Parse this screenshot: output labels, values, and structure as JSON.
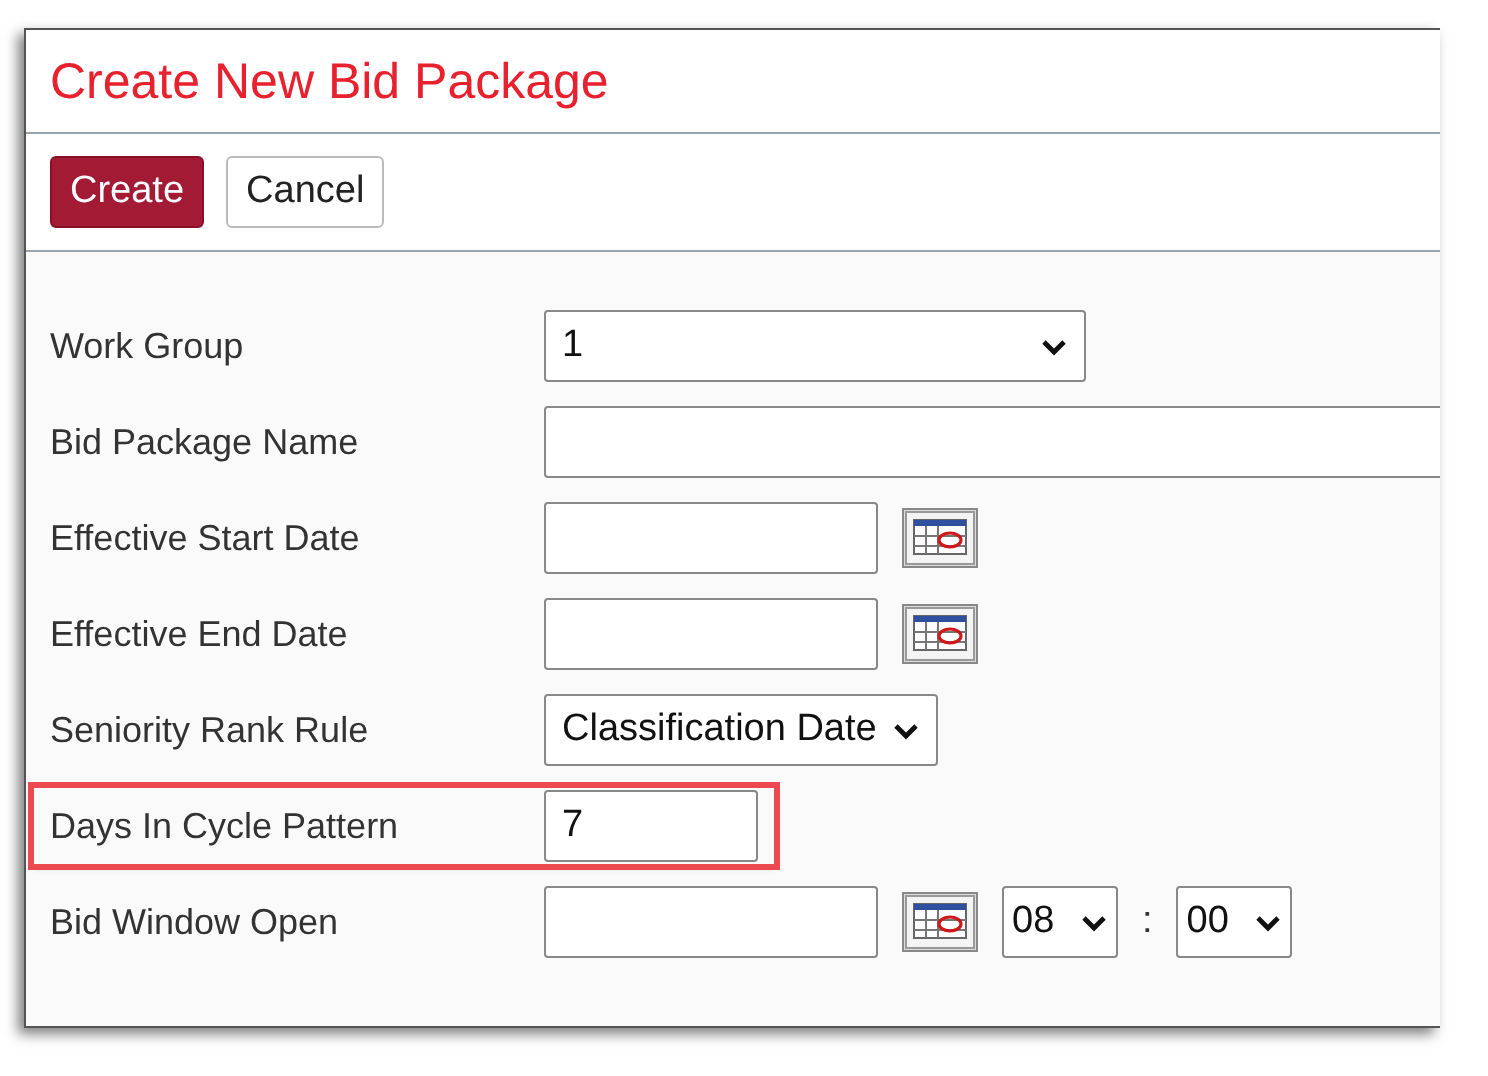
{
  "title": "Create New Bid Package",
  "buttons": [
    {
      "label": "Create",
      "kind": "primary"
    },
    {
      "label": "Cancel",
      "kind": "default"
    }
  ],
  "fields": [
    {
      "label": "Work Group",
      "kind": "select",
      "value": "1",
      "highlighted": false
    },
    {
      "label": "Bid Package Name",
      "kind": "text",
      "highlighted": false
    },
    {
      "label": "Effective Start Date",
      "kind": "date",
      "highlighted": false
    },
    {
      "label": "Effective End Date",
      "kind": "date",
      "highlighted": false
    },
    {
      "label": "Seniority Rank Rule",
      "kind": "select",
      "value": "Classification Date",
      "highlighted": false
    },
    {
      "label": "Days In Cycle Pattern",
      "kind": "text",
      "value": "7",
      "highlighted": true
    },
    {
      "label": "Bid Window Open",
      "kind": "datetime",
      "hour": "08",
      "separator": ":",
      "minute": "00",
      "highlighted": false
    }
  ]
}
